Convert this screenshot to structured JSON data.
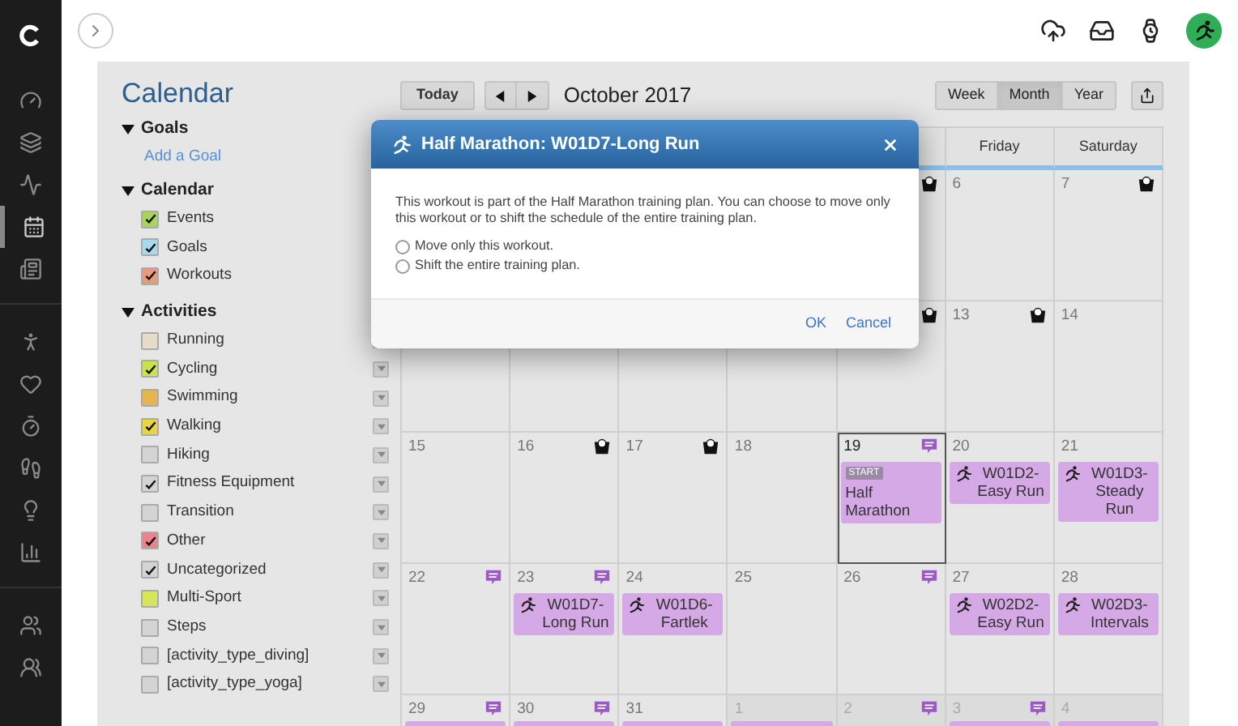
{
  "sidebar": {
    "items": [
      {
        "selected": false
      },
      {
        "selected": false
      },
      {
        "selected": false
      },
      {
        "selected": true
      },
      {
        "selected": false
      },
      {
        "selected": false
      },
      {
        "selected": false
      },
      {
        "selected": false
      },
      {
        "selected": false
      },
      {
        "selected": false
      },
      {
        "selected": false
      },
      {
        "selected": false
      },
      {
        "selected": false
      }
    ]
  },
  "page_title": "Calendar",
  "sections": [
    {
      "title": "Goals",
      "expanded": true,
      "link": "Add a Goal"
    },
    {
      "title": "Calendar",
      "expanded": true,
      "items": [
        {
          "label": "Events",
          "checked": true,
          "color": "#a6d65a"
        },
        {
          "label": "Goals",
          "checked": true,
          "color": "#a9d9ea"
        },
        {
          "label": "Workouts",
          "checked": true,
          "color": "#e99a7e"
        }
      ]
    },
    {
      "title": "Activities",
      "expanded": true,
      "items": [
        {
          "label": "Running",
          "checked": false,
          "color": "#e6dcc8"
        },
        {
          "label": "Cycling",
          "checked": true,
          "color": "#cde24a"
        },
        {
          "label": "Swimming",
          "checked": false,
          "color": "#e8b452"
        },
        {
          "label": "Walking",
          "checked": true,
          "color": "#e8d63e"
        },
        {
          "label": "Hiking",
          "checked": false,
          "color": "#d4d4d4"
        },
        {
          "label": "Fitness Equipment",
          "checked": true,
          "color": "#d4d4d4"
        },
        {
          "label": "Transition",
          "checked": false,
          "color": "#d4d4d4"
        },
        {
          "label": "Other",
          "checked": true,
          "color": "#e8848a"
        },
        {
          "label": "Uncategorized",
          "checked": true,
          "color": "#d4d4d4"
        },
        {
          "label": "Multi-Sport",
          "checked": false,
          "color": "#d6e65c"
        },
        {
          "label": "Steps",
          "checked": false,
          "color": "#d4d4d4"
        },
        {
          "label": "[activity_type_diving]",
          "checked": false,
          "color": "#d4d4d4"
        },
        {
          "label": "[activity_type_yoga]",
          "checked": false,
          "color": "#d4d4d4"
        }
      ]
    }
  ],
  "toolbar": {
    "today": "Today",
    "month_label": "October 2017",
    "views": [
      {
        "label": "Week",
        "selected": false
      },
      {
        "label": "Month",
        "selected": true
      },
      {
        "label": "Year",
        "selected": false
      }
    ]
  },
  "calendar": {
    "columns": [
      "Friday",
      "Saturday"
    ],
    "weeks": [
      {
        "cells": [
          {
            "icons": [
              {
                "kind": "scale"
              }
            ]
          },
          {
            "day": "6"
          },
          {
            "day": "7",
            "icons": [
              {
                "kind": "scale"
              }
            ]
          }
        ]
      },
      {
        "cells": [
          {
            "icons": [
              {
                "kind": "scale"
              }
            ]
          },
          {
            "day": "13",
            "icons": [
              {
                "kind": "scale"
              }
            ]
          },
          {
            "day": "14"
          }
        ]
      },
      {
        "cells": [
          {
            "day": "15"
          },
          {
            "day": "16",
            "icons": [
              {
                "kind": "scale"
              }
            ]
          },
          {
            "day": "17",
            "icons": [
              {
                "kind": "scale"
              }
            ]
          },
          {
            "day": "18"
          },
          {
            "day": "19",
            "icons": [
              {
                "kind": "note"
              }
            ],
            "selected": true,
            "events": [
              {
                "kind": "start",
                "badge": "START",
                "title": "Half Marathon"
              }
            ]
          },
          {
            "day": "20",
            "events": [
              {
                "kind": "run",
                "title": "W01D2-Easy Run"
              }
            ]
          },
          {
            "day": "21",
            "events": [
              {
                "kind": "run",
                "title": "W01D3-Steady Run"
              }
            ]
          }
        ]
      },
      {
        "cells": [
          {
            "day": "22",
            "icons": [
              {
                "kind": "note"
              }
            ]
          },
          {
            "day": "23",
            "icons": [
              {
                "kind": "note"
              }
            ],
            "events": [
              {
                "kind": "run",
                "title": "W01D7-Long Run"
              }
            ]
          },
          {
            "day": "24",
            "events": [
              {
                "kind": "run",
                "title": "W01D6-Fartlek"
              }
            ]
          },
          {
            "day": "25"
          },
          {
            "day": "26",
            "icons": [
              {
                "kind": "note"
              }
            ]
          },
          {
            "day": "27",
            "events": [
              {
                "kind": "run",
                "title": "W02D2-Easy Run"
              }
            ]
          },
          {
            "day": "28",
            "events": [
              {
                "kind": "run",
                "title": "W02D3-Intervals"
              }
            ]
          }
        ]
      },
      {
        "cells": [
          {
            "day": "29",
            "icons": [
              {
                "kind": "note"
              }
            ],
            "more": true
          },
          {
            "day": "30",
            "icons": [
              {
                "kind": "note"
              }
            ],
            "more": true
          },
          {
            "day": "31",
            "more": true
          },
          {
            "day": "1",
            "other_month": true,
            "more": true
          },
          {
            "day": "2",
            "other_month": true,
            "icons": [
              {
                "kind": "note"
              }
            ]
          },
          {
            "day": "3",
            "other_month": true,
            "icons": [
              {
                "kind": "note"
              }
            ],
            "more": true
          },
          {
            "day": "4",
            "other_month": true,
            "more": true
          }
        ]
      }
    ]
  },
  "dialog": {
    "title": "Half Marathon: W01D7-Long Run",
    "message": "This workout is part of the Half Marathon training plan. You can choose to move only this workout or to shift the schedule of the entire training plan.",
    "options": [
      {
        "label": "Move only this workout.",
        "selected": false
      },
      {
        "label": "Shift the entire training plan.",
        "selected": false
      }
    ],
    "buttons": [
      "OK",
      "Cancel"
    ]
  }
}
